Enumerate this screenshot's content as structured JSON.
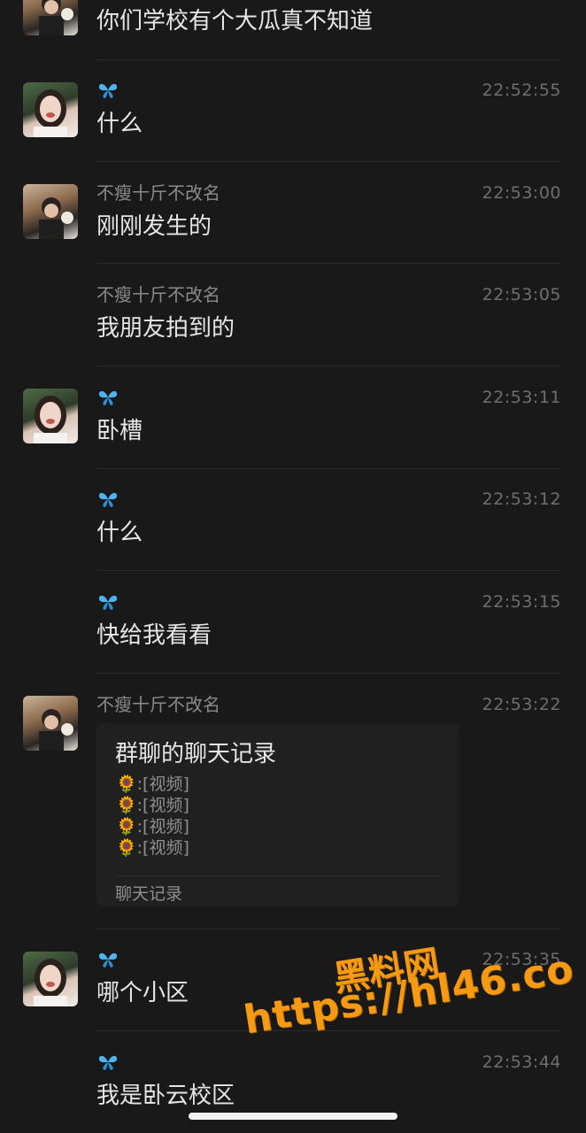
{
  "messages": [
    {
      "sender": "",
      "time": "",
      "text": "你们学校有个大瓜真不知道"
    },
    {
      "sender": "🦋",
      "time": "22:52:55",
      "text": "什么"
    },
    {
      "sender": "不瘦十斤不改名",
      "time": "22:53:00",
      "text": "刚刚发生的"
    },
    {
      "sender": "不瘦十斤不改名",
      "time": "22:53:05",
      "text": "我朋友拍到的"
    },
    {
      "sender": "🦋",
      "time": "22:53:11",
      "text": "卧槽"
    },
    {
      "sender": "🦋",
      "time": "22:53:12",
      "text": "什么"
    },
    {
      "sender": "🦋",
      "time": "22:53:15",
      "text": "快给我看看"
    },
    {
      "sender": "不瘦十斤不改名",
      "time": "22:53:22",
      "text": ""
    },
    {
      "sender": "🦋",
      "time": "22:53:35",
      "text": "哪个小区"
    },
    {
      "sender": "🦋",
      "time": "22:53:44",
      "text": "我是卧云校区"
    }
  ],
  "card": {
    "title": "群聊的聊天记录",
    "lines": [
      "🌻:[视频]",
      "🌻:[视频]",
      "🌻:[视频]",
      "🌻:[视频]"
    ],
    "footer": "聊天记录"
  },
  "watermark": {
    "line1": "黑料网",
    "line2": "https://hl46.co",
    "color": "#f59a12"
  },
  "colors": {
    "background": "#191919",
    "text": "#e6e6e6",
    "meta": "#8a8a8a"
  }
}
